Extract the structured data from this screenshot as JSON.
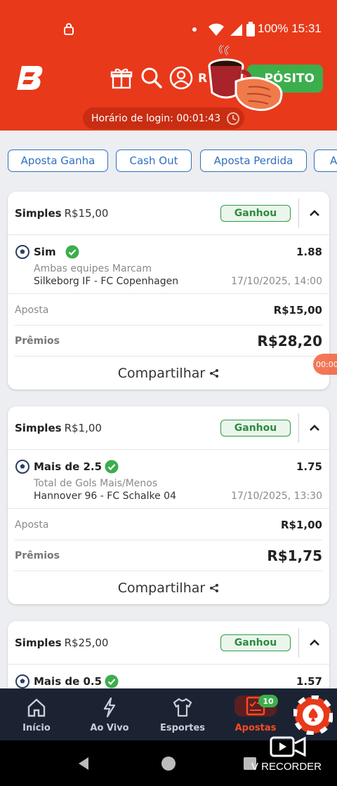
{
  "status_bar": {
    "battery": "100%",
    "time": "15:31"
  },
  "header": {
    "brand_logo": "B",
    "deposit_label": "DEPÓSITO",
    "deposit_visible": "PÓSITO",
    "name_fragment": "R",
    "login_time": "Horário de login: 00:01:43",
    "icons": [
      "gift-icon",
      "search-icon",
      "user-icon"
    ]
  },
  "filters": [
    "Aposta Ganha",
    "Cash Out",
    "Aposta Perdida",
    "A"
  ],
  "bets": [
    {
      "type": "Simples",
      "stake_header": "R$15,00",
      "status": "Ganhou",
      "pick": "Sim",
      "odd": "1.88",
      "market": "Ambas equipes Marcam",
      "match": "Silkeborg IF - FC Copenhagen",
      "date": "17/10/2025, 14:00",
      "stake_label": "Aposta",
      "stake": "R$15,00",
      "prize_label": "Prêmios",
      "prize": "R$28,20",
      "share": "Compartilhar"
    },
    {
      "type": "Simples",
      "stake_header": "R$1,00",
      "status": "Ganhou",
      "pick": "Mais de 2.5",
      "odd": "1.75",
      "market": "Total de Gols Mais/Menos",
      "match": "Hannover 96 - FC Schalke 04",
      "date": "17/10/2025, 13:30",
      "stake_label": "Aposta",
      "stake": "R$1,00",
      "prize_label": "Prêmios",
      "prize": "R$1,75",
      "share": "Compartilhar"
    },
    {
      "type": "Simples",
      "stake_header": "R$25,00",
      "status": "Ganhou",
      "pick": "Mais de 0.5",
      "odd": "1.57"
    }
  ],
  "side_timer": "00:00",
  "bottom_nav": {
    "items": [
      {
        "label": "Início",
        "icon": "home-icon"
      },
      {
        "label": "Ao Vivo",
        "icon": "lightning-icon"
      },
      {
        "label": "Esportes",
        "icon": "jersey-icon"
      },
      {
        "label": "Apostas",
        "icon": "betslip-icon",
        "active": true
      }
    ],
    "apostas_badge": "10"
  },
  "recorder_label": "V RECORDER",
  "colors": {
    "brand": "#e8391a",
    "success": "#3cae4c",
    "chip_blue": "#2f6fbf",
    "nav_bg": "#1b2333",
    "active": "#ff4a1f"
  }
}
